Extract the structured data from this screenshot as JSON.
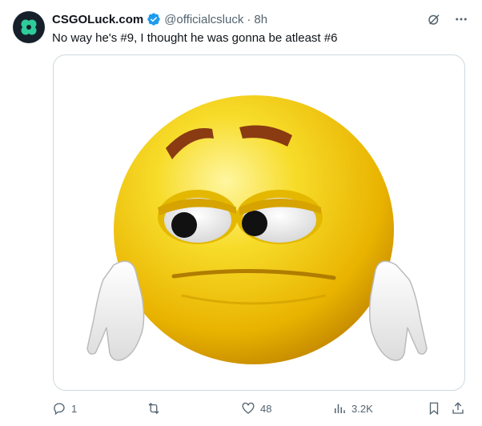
{
  "tweet": {
    "author_name": "CSGOLuck.com",
    "handle": "@officialcsluck",
    "separator": "·",
    "time": "8h",
    "text": "No way he's #9, I thought he was gonna be atleast #6"
  },
  "media": {
    "description_icon": "sad-face-emoji-image"
  },
  "actions": {
    "replies": "1",
    "retweets": "",
    "likes": "48",
    "views": "3.2K"
  },
  "colors": {
    "text": "#0f1419",
    "muted": "#536471",
    "verified": "#1d9bf0",
    "border": "#cfd9de"
  }
}
